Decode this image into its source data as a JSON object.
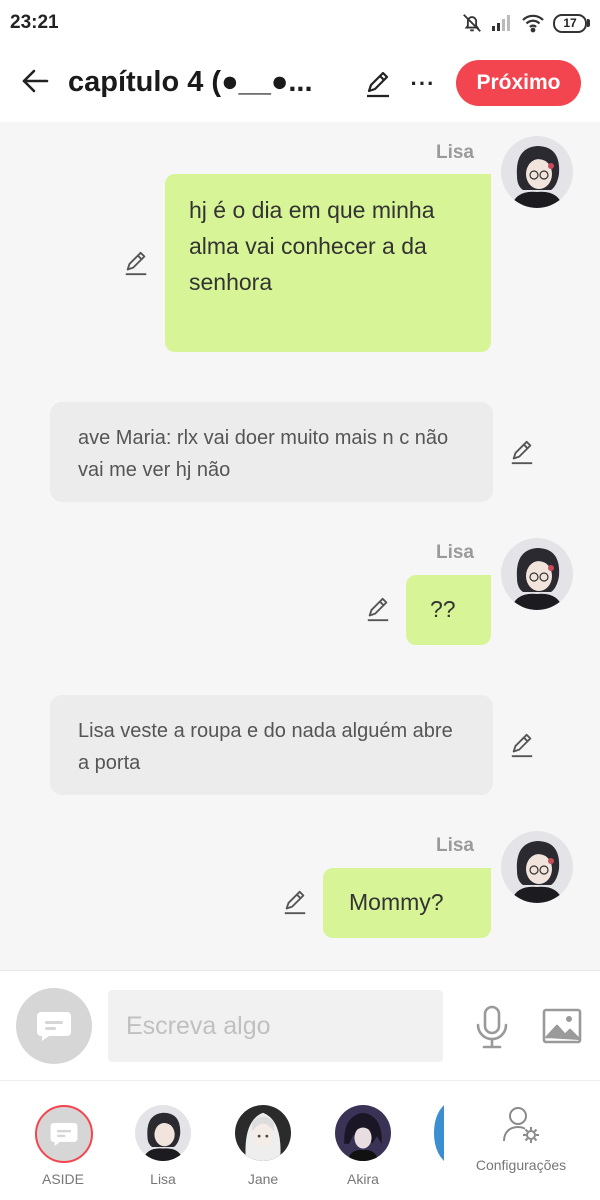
{
  "status_bar": {
    "time": "23:21",
    "battery": "17",
    "icons": [
      "bell-muted-icon",
      "signal-icon",
      "wifi-icon",
      "battery-icon"
    ]
  },
  "header": {
    "back_icon": "arrow-left-icon",
    "title": "capítulo 4  (●__●...",
    "edit_icon": "pencil-icon",
    "more_label": "···",
    "next_label": "Próximo",
    "next_color": "#f2454f"
  },
  "messages": [
    {
      "type": "character",
      "sender": "Lisa",
      "text": "hj é o dia em que minha alma vai conhecer a da senhora"
    },
    {
      "type": "narration",
      "text": "ave Maria: rlx vai doer muito mais n c não vai me ver hj não"
    },
    {
      "type": "character",
      "sender": "Lisa",
      "text": "??"
    },
    {
      "type": "narration",
      "text": "Lisa veste a roupa e do nada alguém abre a porta"
    },
    {
      "type": "character",
      "sender": "Lisa",
      "text": "Mommy?"
    }
  ],
  "colors": {
    "bubble_outgoing": "#d7f597",
    "bubble_narration": "#ececec",
    "accent": "#f2454f"
  },
  "composer": {
    "placeholder": "Escreva algo",
    "icons": [
      "chat-bubble-icon",
      "microphone-icon",
      "image-icon"
    ]
  },
  "bottom_nav": {
    "items": [
      {
        "label": "ASIDE",
        "icon": "chat-bubble-icon"
      },
      {
        "label": "Lisa"
      },
      {
        "label": "Jane"
      },
      {
        "label": "Akira"
      }
    ],
    "settings_label": "Configurações",
    "settings_icon": "user-settings-icon"
  }
}
